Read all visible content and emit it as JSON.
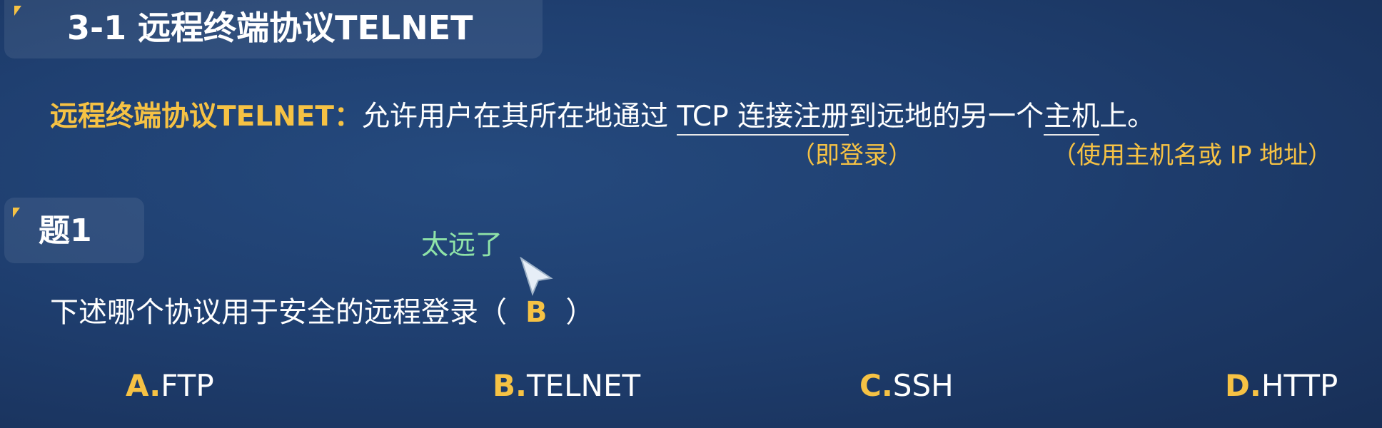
{
  "section": {
    "title": "3-1 远程终端协议TELNET"
  },
  "definition": {
    "term": "远程终端协议TELNET：",
    "text_a": "允许用户在其所在地通过 ",
    "underlined_1": "TCP 连接注册",
    "text_b": "到远地的另一个",
    "underlined_2": "主机",
    "text_c": "上。",
    "note_login": "（即登录）",
    "note_host": "（使用主机名或 IP 地址）"
  },
  "question": {
    "heading": "题1",
    "prompt": "下述哪个协议用于安全的远程登录（",
    "answer": "B",
    "close": "）",
    "options": [
      {
        "letter": "A.",
        "text": "FTP"
      },
      {
        "letter": "B.",
        "text": "TELNET"
      },
      {
        "letter": "C.",
        "text": "SSH"
      },
      {
        "letter": "D.",
        "text": "HTTP"
      }
    ]
  },
  "annotation": {
    "text": "太远了"
  },
  "colors": {
    "accent": "#f6c244",
    "annotation": "#8fe3a8",
    "background": "#1f3f70"
  }
}
